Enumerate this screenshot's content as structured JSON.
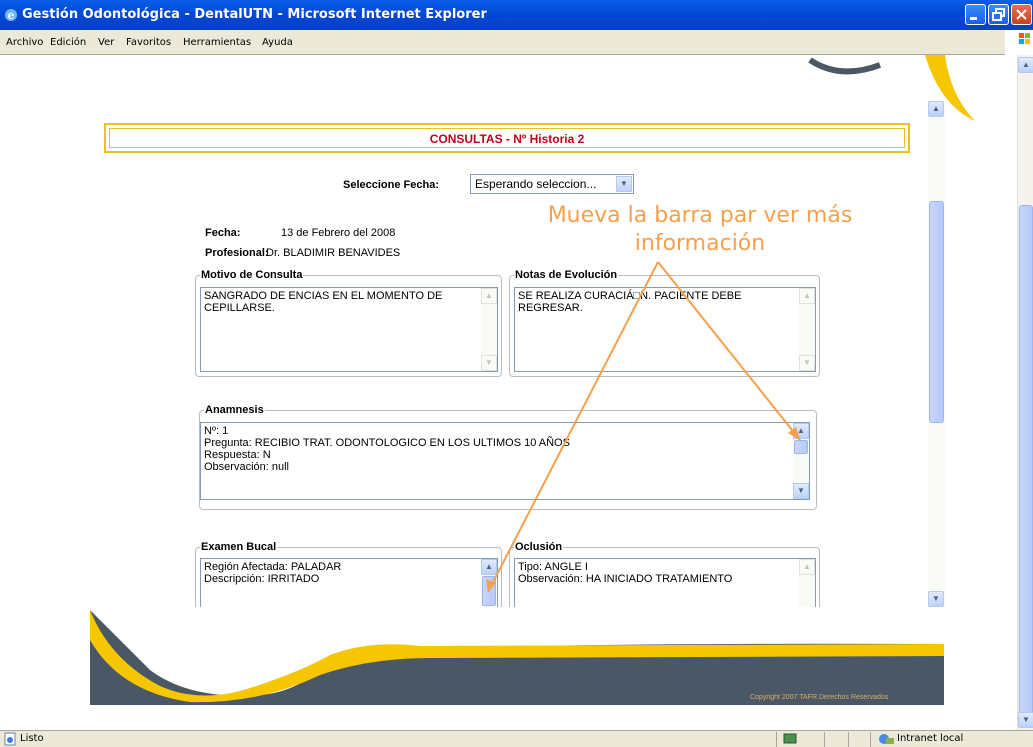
{
  "window": {
    "title": "Gestión Odontológica - DentalUTN - Microsoft Internet Explorer"
  },
  "menu": [
    "Archivo",
    "Edición",
    "Ver",
    "Favoritos",
    "Herramientas",
    "Ayuda"
  ],
  "page": {
    "header_title": "CONSULTAS - Nº Historia 2",
    "select_label": "Seleccione Fecha:",
    "select_value": "Esperando seleccion...",
    "fecha_label": "Fecha:",
    "fecha_value": "13 de Febrero del 2008",
    "profesional_label": "Profesional:",
    "profesional_value": "Dr. BLADIMIR BENAVIDES",
    "motivo": {
      "legend": "Motivo de Consulta",
      "text": "SANGRADO DE ENCIAS EN EL MOMENTO DE CEPILLARSE."
    },
    "notas": {
      "legend": "Notas de Evolución",
      "text": "SE REALIZA CURACIÁ□N. PACIENTE DEBE REGRESAR."
    },
    "anamnesis": {
      "legend": "Anamnesis",
      "lines": [
        "Nº: 1",
        "Pregunta: RECIBIO TRAT. ODONTOLOGICO EN LOS ULTIMOS 10 AÑOS",
        "Respuesta: N",
        "Observación: null"
      ]
    },
    "examen": {
      "legend": "Examen Bucal",
      "lines": [
        "Región Afectada: PALADAR",
        "Descripción: IRRITADO"
      ]
    },
    "oclusion": {
      "legend": "Oclusión",
      "lines": [
        "Tipo: ANGLE I",
        "Observación: HA INICIADO TRATAMIENTO"
      ]
    },
    "copyright": "Copyright 2007 TAFR Derechos Reservados"
  },
  "annotation": {
    "line1": "Mueva la barra par ver más",
    "line2": "información",
    "color": "#f5a04a"
  },
  "status": {
    "text": "Listo",
    "zone": "Intranet local"
  }
}
